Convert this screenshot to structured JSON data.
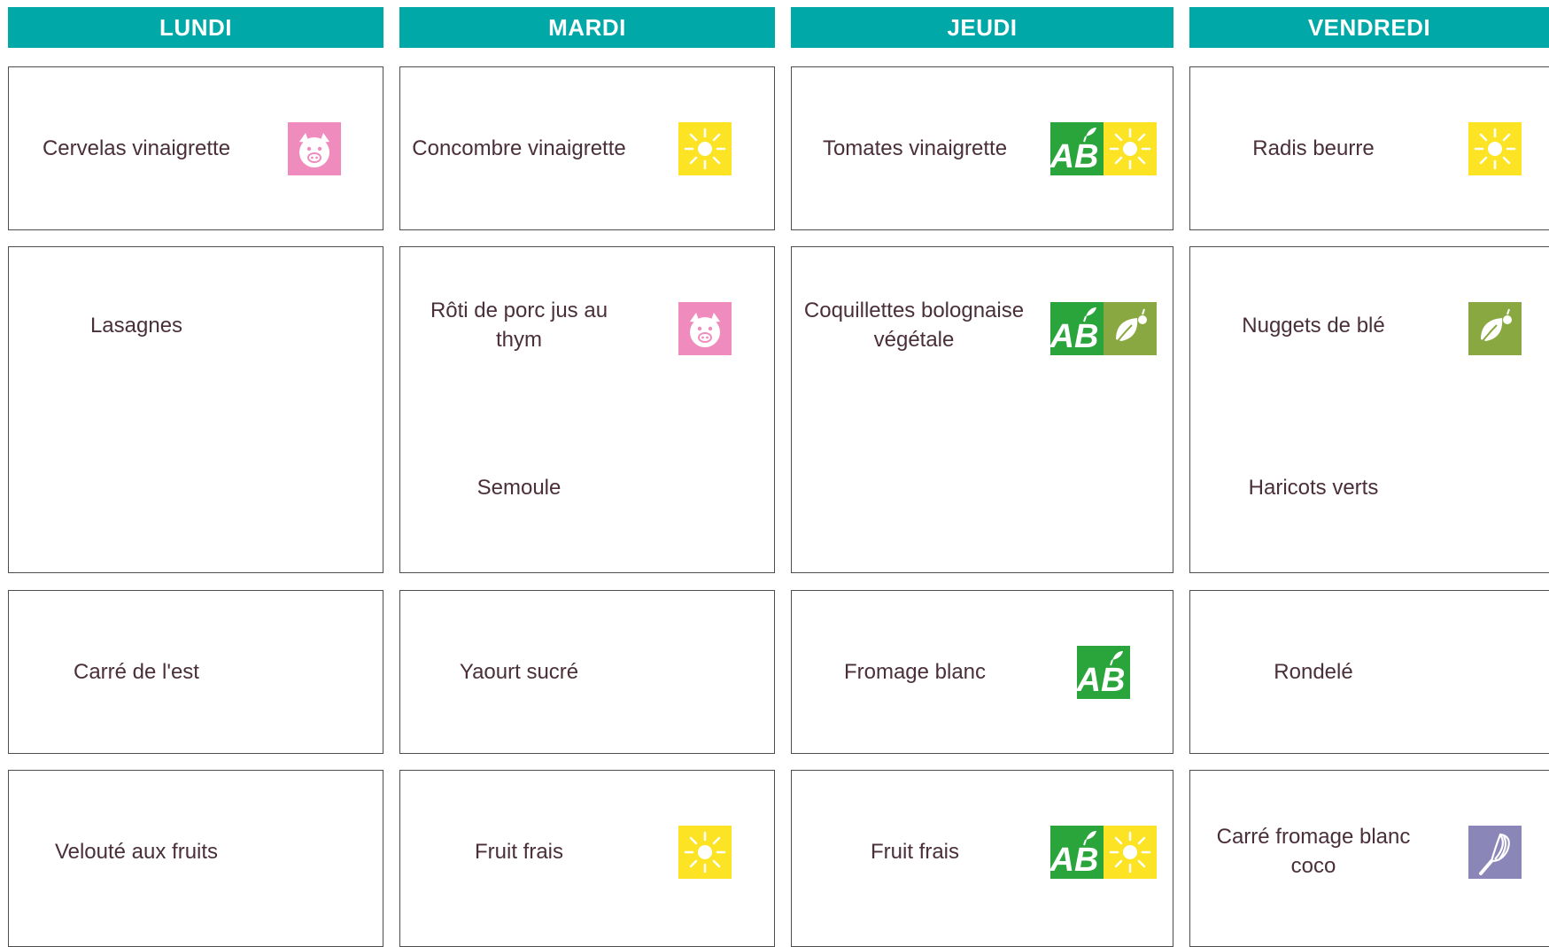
{
  "days": [
    "LUNDI",
    "MARDI",
    "JEUDI",
    "VENDREDI"
  ],
  "colors": {
    "header": "#00a8a8",
    "text": "#4a2f3a",
    "border": "#4d4d4d",
    "pork": "#f08cbd",
    "season": "#fce425",
    "bio": "#2aa53c",
    "veg": "#8aa841",
    "homemade": "#8a86b8"
  },
  "menu": {
    "row1": [
      {
        "label": "Cervelas vinaigrette",
        "badges": [
          "pork-icon"
        ]
      },
      {
        "label": "Concombre vinaigrette",
        "badges": [
          "sun-icon"
        ]
      },
      {
        "label": "Tomates vinaigrette",
        "badges": [
          "organic-ab-icon",
          "sun-icon"
        ]
      },
      {
        "label": "Radis beurre",
        "badges": [
          "sun-icon"
        ]
      }
    ],
    "row2_main": [
      {
        "label": "Lasagnes",
        "badges": []
      },
      {
        "label": "Rôti de porc jus au thym",
        "badges": [
          "pork-icon"
        ]
      },
      {
        "label": "Coquillettes bolognaise végétale",
        "badges": [
          "organic-ab-icon",
          "vegetarian-leaf-icon"
        ]
      },
      {
        "label": "Nuggets de blé",
        "badges": [
          "vegetarian-leaf-icon"
        ]
      }
    ],
    "row2_side": [
      {
        "label": ""
      },
      {
        "label": "Semoule"
      },
      {
        "label": ""
      },
      {
        "label": "Haricots verts"
      }
    ],
    "row3": [
      {
        "label": "Carré de l'est",
        "badges": []
      },
      {
        "label": "Yaourt sucré",
        "badges": []
      },
      {
        "label": "Fromage blanc",
        "badges": [
          "organic-ab-icon"
        ]
      },
      {
        "label": "Rondelé",
        "badges": []
      }
    ],
    "row4": [
      {
        "label": "Velouté aux fruits",
        "badges": []
      },
      {
        "label": "Fruit frais",
        "badges": [
          "sun-icon"
        ]
      },
      {
        "label": "Fruit frais",
        "badges": [
          "organic-ab-icon",
          "sun-icon"
        ]
      },
      {
        "label": "Carré fromage blanc coco",
        "badges": [
          "homemade-whisk-icon"
        ]
      }
    ]
  }
}
